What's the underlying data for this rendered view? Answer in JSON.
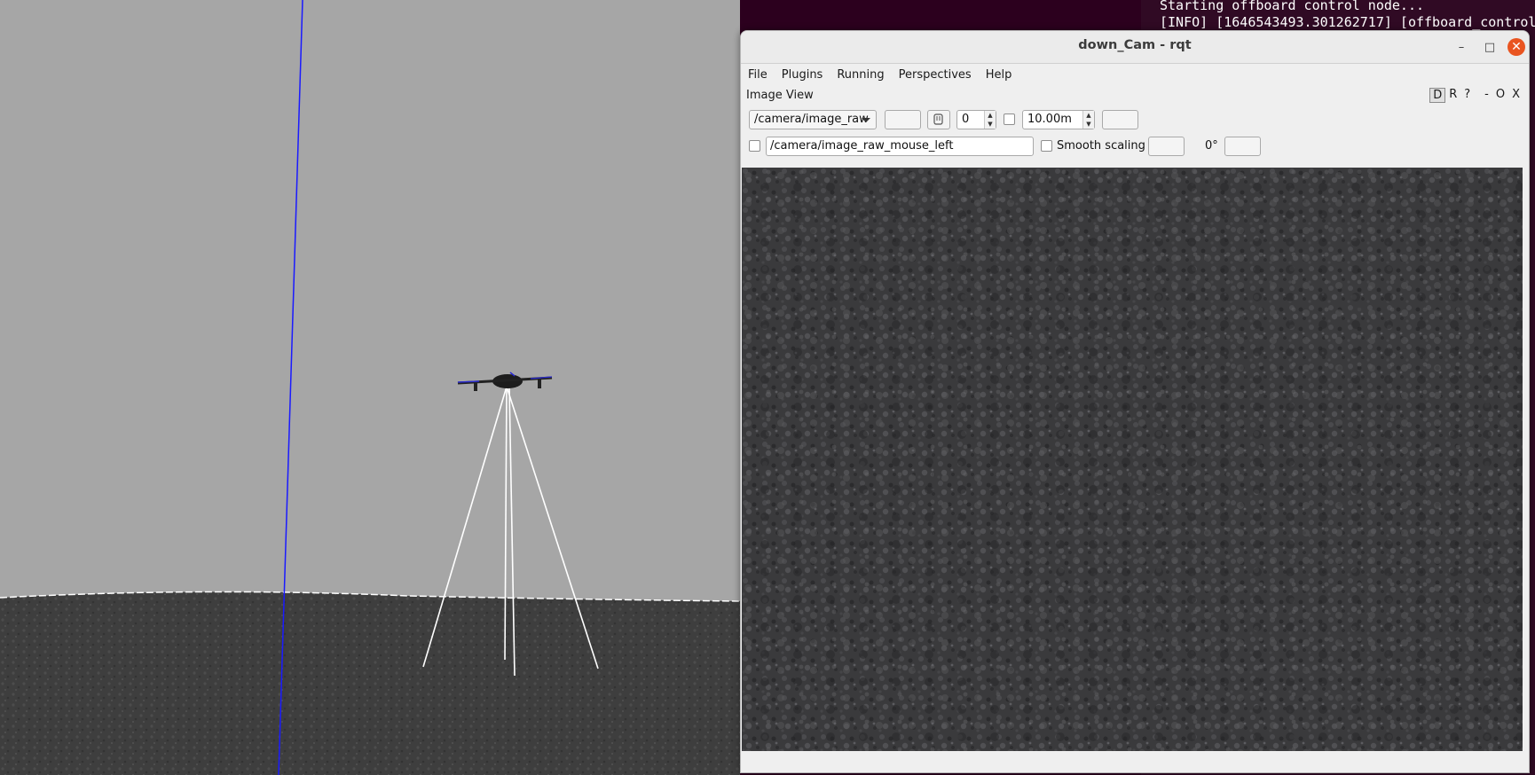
{
  "terminal": {
    "lines": [
      "Starting offboard control node...",
      "[INFO] [1646543493.301262717] [offboard_control"
    ]
  },
  "rqt": {
    "title": "down_Cam - rqt",
    "window_buttons": {
      "minimize": "–",
      "maximize": "□",
      "close": "✕"
    },
    "menus": [
      "File",
      "Plugins",
      "Running",
      "Perspectives",
      "Help"
    ],
    "plugin": {
      "title": "Image View",
      "controls": [
        "D",
        "R",
        "?",
        "-",
        "O",
        "X"
      ]
    },
    "toolbar": {
      "topic": "/camera/image_raw",
      "spin_value": "0",
      "distance_value": "10.00m",
      "mouse_topic": "/camera/image_raw_mouse_left",
      "smooth_scaling_label": "Smooth scaling",
      "rotation_label": "0°"
    }
  },
  "scene": {
    "colors": {
      "sky": "#a6a6a6",
      "ground": "#3d3d3d",
      "z_axis": "#1a1aff",
      "sensor_lines": "#ffffff"
    }
  }
}
